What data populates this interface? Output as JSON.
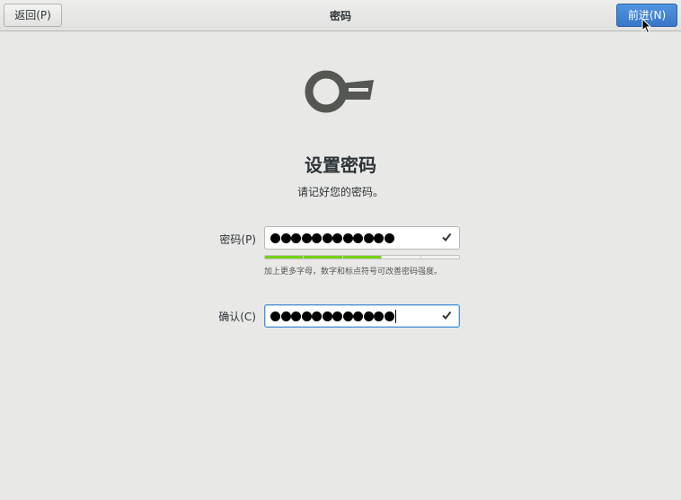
{
  "header": {
    "back_label": "返回(P)",
    "title": "密码",
    "next_label": "前进(N)"
  },
  "main": {
    "icon": "key-icon",
    "heading": "设置密码",
    "subtitle": "请记好您的密码。",
    "password": {
      "label": "密码(P)",
      "masked_length": 12,
      "valid": true,
      "strength_segments_total": 5,
      "strength_segments_filled": 3,
      "hint": "加上更多字母，数字和标点符号可改善密码强度。"
    },
    "confirm": {
      "label": "确认(C)",
      "masked_length": 12,
      "valid": true
    }
  },
  "colors": {
    "accent": "#4a90d9",
    "strength_fill": "#73d216",
    "background": "#e8e8e7"
  }
}
